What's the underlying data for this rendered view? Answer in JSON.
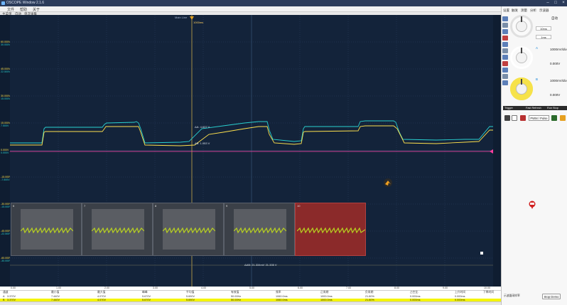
{
  "window": {
    "title": "OSCOPE Window 2.1.6"
  },
  "menu": [
    "文件",
    "帮助",
    "关于"
  ],
  "toolbar": {
    "items": [
      "主菜单",
      "自动",
      "单次采集"
    ]
  },
  "scope": {
    "mode_label": "Main Line",
    "trigger_time": "1000ms",
    "cursor_label_1": "ΔA: 4.637 V",
    "cursor_label_2": "ΔB: 1.053 V",
    "cursor_label_3": "ΔAB: 21.334mV  21.335 V",
    "colors": {
      "bg": "#13233a",
      "chA": "#ffe14d",
      "chB": "#29d0d0",
      "trig": "#ff3fa0",
      "cursor": "#c8a84a"
    }
  },
  "y_labels": [
    {
      "a": "60.000V",
      "b": "30.000V"
    },
    {
      "a": "45.000V",
      "b": "22.500V"
    },
    {
      "a": "30.000V",
      "b": "15.000V"
    },
    {
      "a": "15.000V",
      "b": "7.500V"
    },
    {
      "a": "0.000V",
      "b": "0.000V"
    },
    {
      "a": "-15.000V",
      "b": "-7.500V"
    },
    {
      "a": "-30.000V",
      "b": "-15.000V"
    },
    {
      "a": "-45.000V",
      "b": "-22.500V"
    },
    {
      "a": "-60.000V",
      "b": "-30.000V"
    }
  ],
  "x_labels": [
    "0.00",
    "1.00",
    "2.00",
    "3.00",
    "4.00",
    "5.00",
    "6.00",
    "7.00",
    "8.00",
    "9.00",
    "10.00"
  ],
  "thumbnails": [
    {
      "num": "6",
      "selected": false
    },
    {
      "num": "7",
      "selected": false
    },
    {
      "num": "8",
      "selected": false
    },
    {
      "num": "9",
      "selected": false
    },
    {
      "num": "10",
      "selected": true
    }
  ],
  "measurements": {
    "headers": [
      "通道",
      "最小值",
      "最大值",
      "峰峰",
      "平均值",
      "有效值",
      "频率",
      "正周期",
      "负周期",
      "占空比",
      "上升时间",
      "下降时间"
    ],
    "rows": [
      [
        "A",
        "3.370V",
        "7.440V",
        "4.070V",
        "5.670V",
        "5.690V",
        "50.00Hz",
        "1060.0ms",
        "1000.0ms",
        "21.80%",
        "0.000ms",
        "0.000ms"
      ],
      [
        "B",
        "3.370V",
        "7.440V",
        "4.070V",
        "5.670V",
        "5.690V",
        "50.00Hz",
        "1060.0ms",
        "1000.0ms",
        "21.80%",
        "0.000ms",
        "0.000ms"
      ]
    ]
  },
  "panel": {
    "tabs": [
      "设置",
      "触发",
      "测量",
      "分析",
      "示波器"
    ],
    "timebase": {
      "value": "10ms",
      "sub": "1ms",
      "auto": "自动"
    },
    "channel_a": {
      "label": "A",
      "volt": "1000mV/div",
      "offset": "0.000V"
    },
    "channel_b": {
      "label": "B",
      "volt": "1000mV/div",
      "offset": "0.000V"
    },
    "strip": {
      "left": "Trigger",
      "mid": "Fast Refresh",
      "right": "Run Stop"
    },
    "pwm_label": "PWM / Pulse",
    "stop_demo": "Stop Demo",
    "small_slider": "示波器采样率"
  }
}
